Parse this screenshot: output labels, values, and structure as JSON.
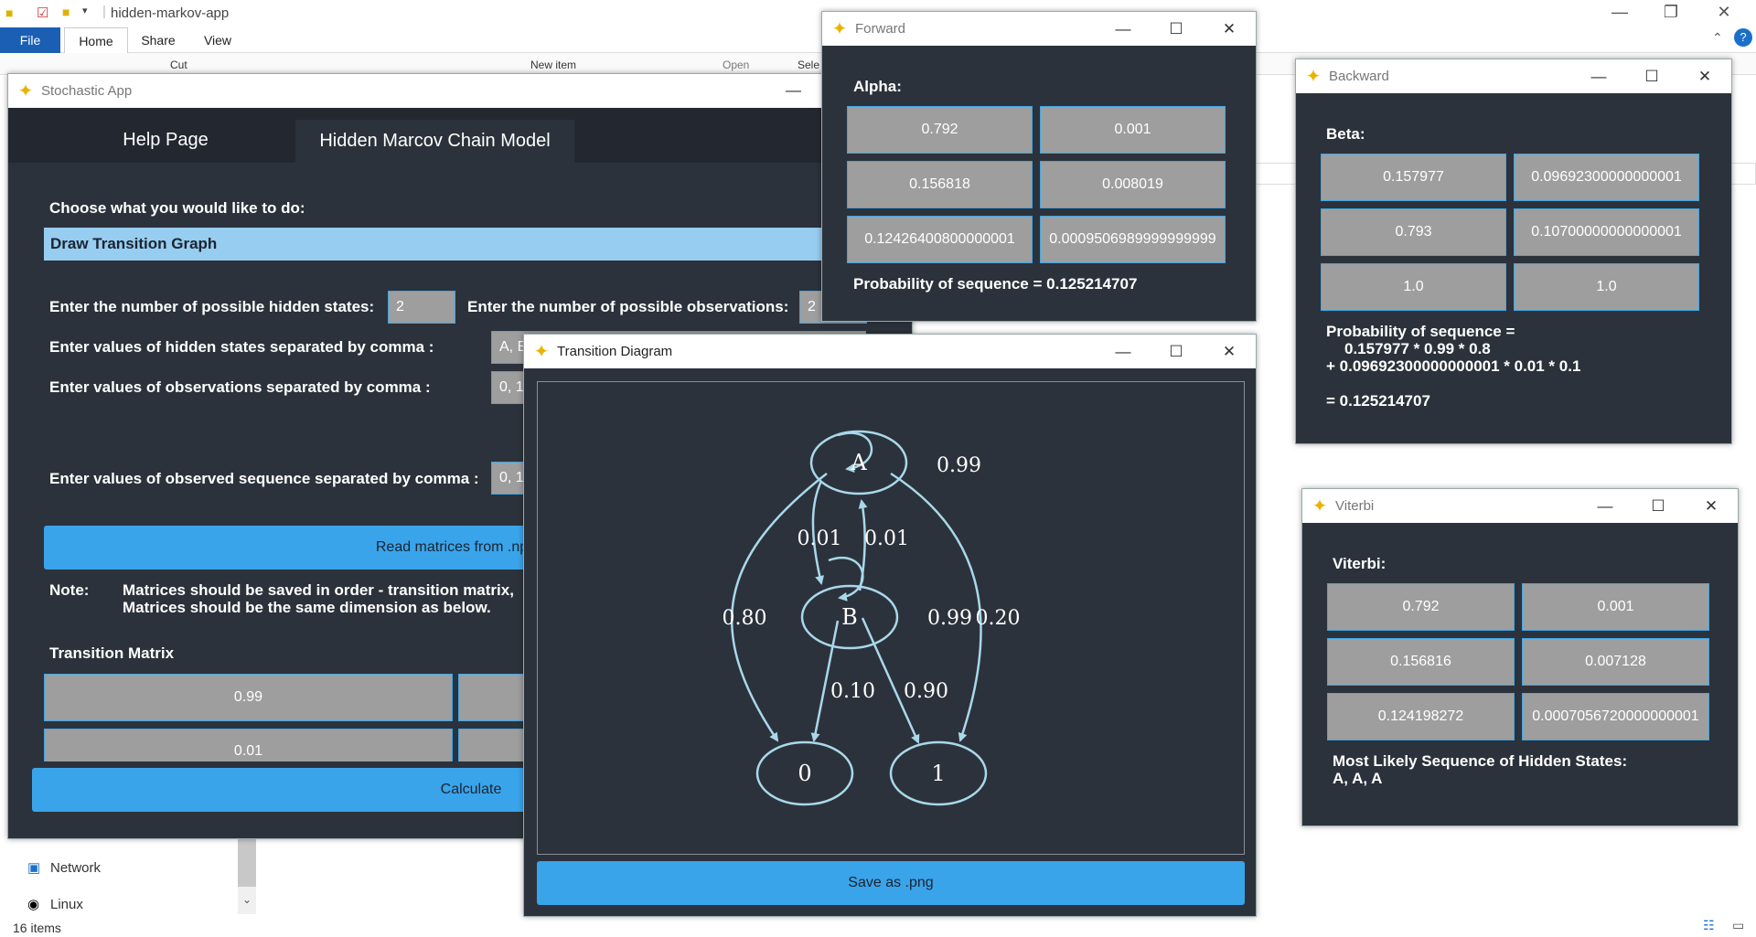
{
  "explorer": {
    "title": "hidden-markov-app",
    "file_tab": "File",
    "tabs": [
      "Home",
      "Share",
      "View"
    ],
    "ribbon_items": [
      "Cut",
      "New item",
      "Open",
      "Sele"
    ],
    "nav_items": [
      "Network",
      "Linux"
    ],
    "status": "16 items"
  },
  "stochastic": {
    "title": "Stochastic App",
    "tabs": [
      "Help Page",
      "Hidden Marcov Chain Model"
    ],
    "choose_label": "Choose what you would like to do:",
    "choice_selected": "Draw Transition Graph",
    "hidden_states_label": "Enter the number of possible hidden states:",
    "hidden_states_value": "2",
    "observations_label": "Enter the number of possible observations:",
    "observations_value": "2",
    "states_values_label": "Enter values of hidden states separated by comma :",
    "states_values_value": "A, B",
    "obs_values_label": "Enter values of observations separated by comma :",
    "obs_values_value": "0, 1",
    "sequence_label": "Enter values of observed sequence separated by comma :",
    "sequence_value": "0, 1",
    "read_button": "Read matrices from .npz",
    "note_label": "Note:",
    "note_line1": "Matrices should be saved in order - transition matrix,",
    "note_line2": "Matrices should be the same dimension as below.",
    "transition_label": "Transition Matrix",
    "transition_cells": [
      "0.99",
      "",
      "0.01",
      ""
    ],
    "calculate_button": "Calculate"
  },
  "forward": {
    "title": "Forward",
    "alpha_label": "Alpha:",
    "cells": [
      "0.792",
      "0.001",
      "0.156818",
      "0.008019",
      "0.12426400800000001",
      "0.0009506989999999999"
    ],
    "prob_text": "Probability of sequence = 0.125214707"
  },
  "backward": {
    "title": "Backward",
    "beta_label": "Beta:",
    "cells": [
      "0.157977",
      "0.09692300000000001",
      "0.793",
      "0.10700000000000001",
      "1.0",
      "1.0"
    ],
    "prob_line1": "Probability of sequence =",
    "prob_line2": "0.157977 * 0.99 * 0.8",
    "prob_line3": "+ 0.09692300000000001 * 0.01 * 0.1",
    "prob_line4": "= 0.125214707"
  },
  "viterbi": {
    "title": "Viterbi",
    "viterbi_label": "Viterbi:",
    "cells": [
      "0.792",
      "0.001",
      "0.156816",
      "0.007128",
      "0.124198272",
      "0.0007056720000000001"
    ],
    "seq_label": "Most Likely Sequence of Hidden States:",
    "seq_value": "A, A, A"
  },
  "diagram": {
    "title": "Transition Diagram",
    "save_button": "Save as .png",
    "nodes": {
      "a": "A",
      "b": "B",
      "o0": "0",
      "o1": "1"
    },
    "edges": {
      "aa": "0.99",
      "ab": "0.01",
      "ba": "0.01",
      "bb": "0.99",
      "a0": "0.80",
      "a1": "0.20",
      "b0": "0.10",
      "b1": "0.90"
    },
    "edge_color": "#a8d8ea"
  },
  "colors": {
    "accent": "#3aa4ea",
    "panel": "#2c323b",
    "selected": "#97cdf0"
  }
}
